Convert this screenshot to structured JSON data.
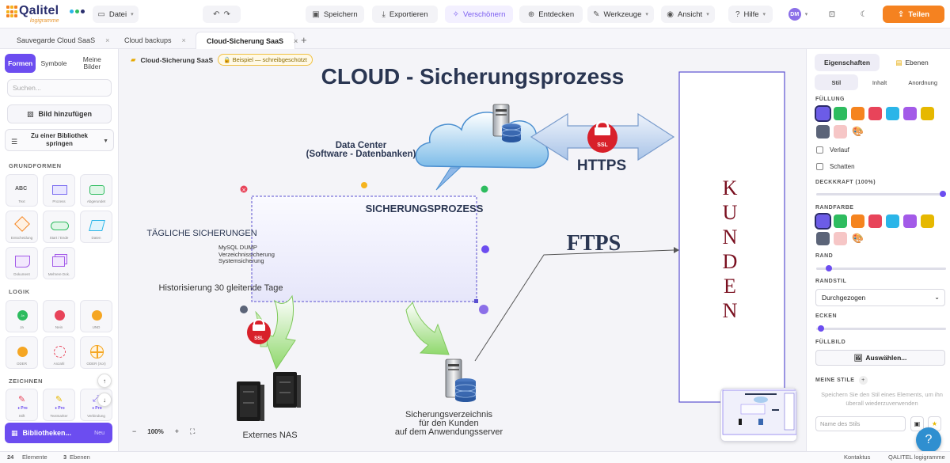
{
  "app": {
    "logo_text": "Qalitel",
    "logo_sub": "logigramme"
  },
  "toolbar": {
    "file_label": "Datei",
    "save_label": "Speichern",
    "export_label": "Exportieren",
    "beautify_label": "Verschönern",
    "discover_label": "Entdecken",
    "tools_label": "Werkzeuge",
    "view_label": "Ansicht",
    "help_label": "Hilfe",
    "avatar_initials": "DM",
    "share_label": "Teilen"
  },
  "tabs": [
    {
      "label": "Sauvegarde Cloud SaaS",
      "color": "#6c4df0"
    },
    {
      "label": "Cloud backups",
      "color": "#22a86a"
    },
    {
      "label": "Cloud-Sicherung SaaS",
      "color": "#f58220"
    }
  ],
  "left_panel": {
    "tabs": [
      "Formen",
      "Symbole",
      "Meine Bilder"
    ],
    "search_placeholder": "Suchen...",
    "add_image_label": "Bild hinzufügen",
    "jump_label": "Zu einer Bibliothek springen",
    "section_basic": "GRUNDFORMEN",
    "section_logic": "LOGIK",
    "section_draw": "ZEICHNEN",
    "basic_shapes": [
      "Text",
      "Prozess",
      "Abgerundet",
      "Entscheidung",
      "Start / Ende",
      "Daten",
      "Dokument",
      "Mehrere Dok."
    ],
    "logic_shapes": [
      "Ja",
      "Nein",
      "UND",
      "ODER",
      "Anzahl",
      "ODER (Xor)"
    ],
    "draw_badges": [
      "Pro",
      "Pro",
      "Pro"
    ],
    "draw_captions": [
      "Stift",
      "Textmarker",
      "Verbindung"
    ],
    "libraries_label": "Bibliotheken...",
    "libraries_tag": "Neu"
  },
  "canvas": {
    "breadcrumb_name": "Cloud-Sicherung SaaS",
    "badge": "Beispiel — schreibgeschützt",
    "zoom": "100%"
  },
  "diagram": {
    "title": "CLOUD - Sicherungsprozess",
    "datacenter_line1": "Data Center",
    "datacenter_line2": "(Software - Datenbanken)",
    "https_label": "HTTPS",
    "ssl_label": "SSL",
    "process_title": "SICHERUNGSPROZESS",
    "daily_label": "TÄGLICHE SICHERUNGEN",
    "daily_items": [
      "MySQL DUMP",
      "Verzeichnissicherung",
      "Systemsicherung"
    ],
    "history_label": "Historisierung 30 gleitende Tage",
    "ftps_label": "FTPS",
    "customers_label": "KUNDEN",
    "customer_letters": [
      "K",
      "U",
      "N",
      "D",
      "E",
      "N"
    ],
    "nas_label": "Externes NAS",
    "backup_dir_line1": "Sicherungsverzeichnis",
    "backup_dir_line2": "für den Kunden",
    "backup_dir_line3": "auf dem Anwendungsserver"
  },
  "right_panel": {
    "tab_properties": "Eigenschaften",
    "tab_layers": "Ebenen",
    "subtabs": [
      "Stil",
      "Inhalt",
      "Anordnung"
    ],
    "fill_label": "FÜLLUNG",
    "gradient_label": "Verlauf",
    "shadow_label": "Schatten",
    "opacity_label": "DECKKRAFT (100%)",
    "border_color_label": "RANDFARBE",
    "border_label": "RAND",
    "border_style_label": "RANDSTIL",
    "border_style_value": "Durchgezogen",
    "corners_label": "ECKEN",
    "fill_image_label": "FÜLLBILD",
    "choose_label": "Auswählen...",
    "my_styles_label": "MEINE STILE",
    "my_styles_note": "Speichern Sie den Stil eines Elements, um ihn überall wiederzuverwenden",
    "style_name_placeholder": "Name des Stils",
    "colors": [
      "#6c5ce7",
      "#2ebc5f",
      "#f5841f",
      "#e8445a",
      "#2bb5e8",
      "#a35ae8",
      "#e6b800",
      "#5b6478",
      "#f6c6c6"
    ]
  },
  "statusbar": {
    "elements_count": "24",
    "elements_label": "Elemente",
    "selected_count": "3",
    "selected_label": "Ebenen",
    "contact_label": "Kontaktus",
    "brand_label": "QALITEL logigramme"
  }
}
